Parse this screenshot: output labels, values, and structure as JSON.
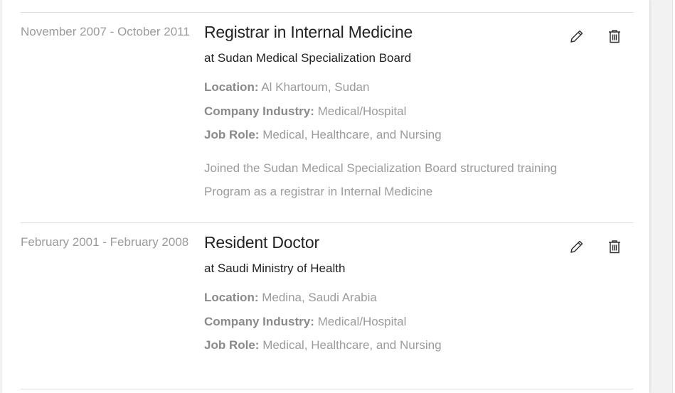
{
  "experience": [
    {
      "date": "November 2007 - October 2011",
      "title": "Registrar in Internal Medicine",
      "company": "at Sudan Medical Specialization Board",
      "location_label": "Location:",
      "location": "Al Khartoum, Sudan",
      "industry_label": "Company Industry:",
      "industry": "Medical/Hospital",
      "role_label": "Job Role:",
      "role": "Medical, Healthcare, and Nursing",
      "description": "Joined the Sudan Medical Specialization Board structured training Program as a registrar in Internal Medicine"
    },
    {
      "date": "February 2001 - February 2008",
      "title": "Resident Doctor",
      "company": "at Saudi Ministry of Health",
      "location_label": "Location:",
      "location": "Medina, Saudi Arabia",
      "industry_label": "Company Industry:",
      "industry": "Medical/Hospital",
      "role_label": "Job Role:",
      "role": "Medical, Healthcare, and Nursing"
    }
  ],
  "icons": {
    "edit": "pencil-icon",
    "delete": "trash-icon"
  },
  "colors": {
    "title": "#222222",
    "muted": "#9b9b9b",
    "label": "#8a8a8a",
    "divider": "#dddddd",
    "icon": "#333333"
  }
}
